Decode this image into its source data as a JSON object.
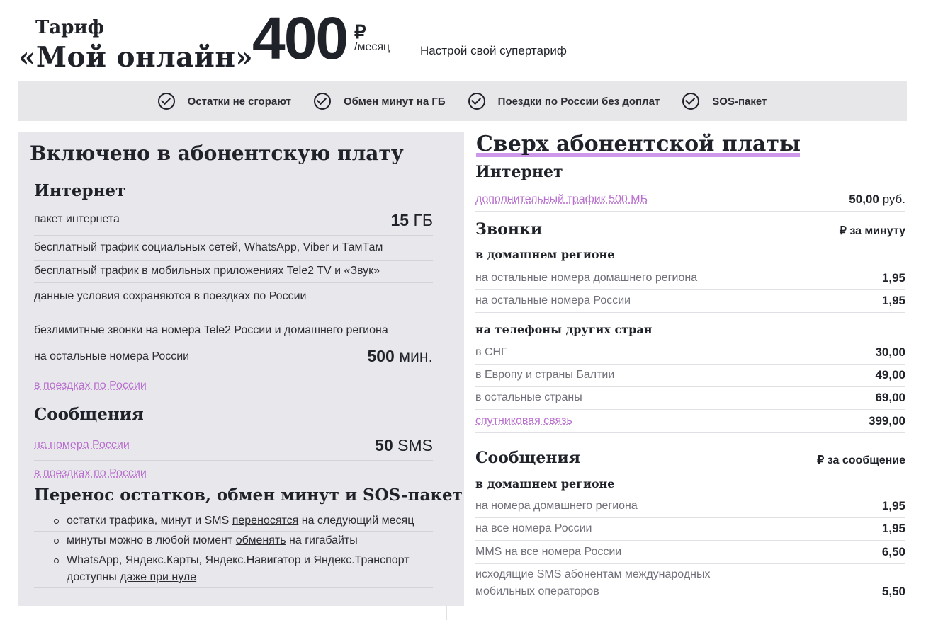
{
  "header": {
    "tariff_word": "Тариф",
    "tariff_name": "«Мой онлайн»",
    "price": "400",
    "currency": "₽",
    "per": "/месяц",
    "promo": "Настрой свой супертариф"
  },
  "features": [
    {
      "label": "Остатки не сгорают",
      "icon": "check-circle-icon"
    },
    {
      "label": "Обмен минут на ГБ",
      "icon": "check-circle-icon"
    },
    {
      "label": "Поездки по России без доплат",
      "icon": "check-circle-icon"
    },
    {
      "label": "SOS-пакет",
      "icon": "check-circle-icon"
    }
  ],
  "included": {
    "title": "Включено в абонентскую плату",
    "internet": {
      "heading": "Интернет",
      "package_label": "пакет интернета",
      "package_value": "15",
      "package_unit": "ГБ",
      "social_line": "бесплатный трафик социальных сетей, WhatsApp, Viber и ТамТам",
      "apps_prefix": "бесплатный трафик в мобильных приложениях ",
      "apps_tv": "Tele2 TV",
      "apps_and": " и ",
      "apps_zvuk": "«Звук»",
      "travel_line": "данные условия сохраняются в поездках по России"
    },
    "calls": {
      "unlimited_line": "безлимитные звонки на номера Tele2 России и домашнего региона",
      "other_label": "на остальные номера России",
      "other_value": "500",
      "other_unit": "мин.",
      "travel_link": "в поездках по России"
    },
    "messages": {
      "heading": "Сообщения",
      "link": "на номера России",
      "value": "50",
      "unit": "SMS",
      "travel_link": "в поездках по России"
    },
    "carryover": {
      "heading": "Перенос остатков, обмен минут и SOS-пакет",
      "b1_a": "остатки трафика, минут и SMS ",
      "b1_link": "переносятся",
      "b1_b": " на следующий месяц",
      "b2_a": "минуты можно в любой момент ",
      "b2_link": "обменять",
      "b2_b": " на гигабайты",
      "b3_a": "WhatsApp, Яндекс.Карты, Яндекс.Навигатор и Яндекс.Транспорт доступны ",
      "b3_link": "даже при нуле"
    }
  },
  "extra": {
    "title": "Сверх абонентской платы",
    "internet": {
      "heading": "Интернет",
      "link": "дополнительный трафик 500 МБ",
      "price": "50,00",
      "currency": "руб."
    },
    "calls": {
      "heading": "Звонки",
      "unit": "₽ за минуту",
      "home_sub": "в домашнем регионе",
      "home_rows": [
        {
          "label": "на остальные номера домашнего региона",
          "price": "1,95"
        },
        {
          "label": "на остальные номера России",
          "price": "1,95"
        }
      ],
      "intl_sub": "на телефоны других стран",
      "intl_rows": [
        {
          "label": "в СНГ",
          "price": "30,00"
        },
        {
          "label": "в Европу и страны Балтии",
          "price": "49,00"
        },
        {
          "label": "в остальные страны",
          "price": "69,00"
        },
        {
          "label": "спутниковая связь",
          "price": "399,00"
        }
      ]
    },
    "messages": {
      "heading": "Сообщения",
      "unit": "₽ за сообщение",
      "home_sub": "в домашнем регионе",
      "rows": [
        {
          "label": "на номера домашнего региона",
          "price": "1,95"
        },
        {
          "label": "на все номера России",
          "price": "1,95"
        },
        {
          "label": "MMS на все номера России",
          "price": "6,50"
        }
      ],
      "intl_label_1": "исходящие SMS абонентам международных",
      "intl_label_2": "мобильных операторов",
      "intl_price": "5,50"
    }
  }
}
